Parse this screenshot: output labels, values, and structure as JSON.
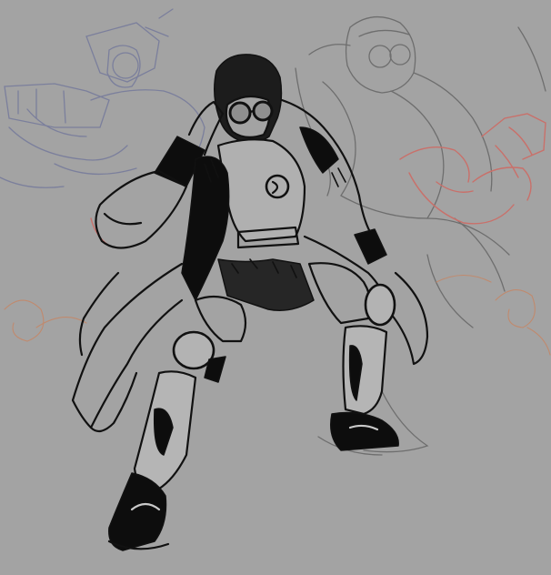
{
  "image": {
    "background_color": "#a3a3a3",
    "ink_color": "#111111",
    "sketch_colors": {
      "gray": "#6e6e6e",
      "blue": "#7b7f9c",
      "red": "#c9706a",
      "orange": "#c08a6e"
    },
    "figures": [
      {
        "name": "blue-mech-sketch"
      },
      {
        "name": "gray-goggle-figure-sketch"
      },
      {
        "name": "red-arm-sketch"
      },
      {
        "name": "inked-goggle-trenchcoat-figure"
      }
    ]
  }
}
